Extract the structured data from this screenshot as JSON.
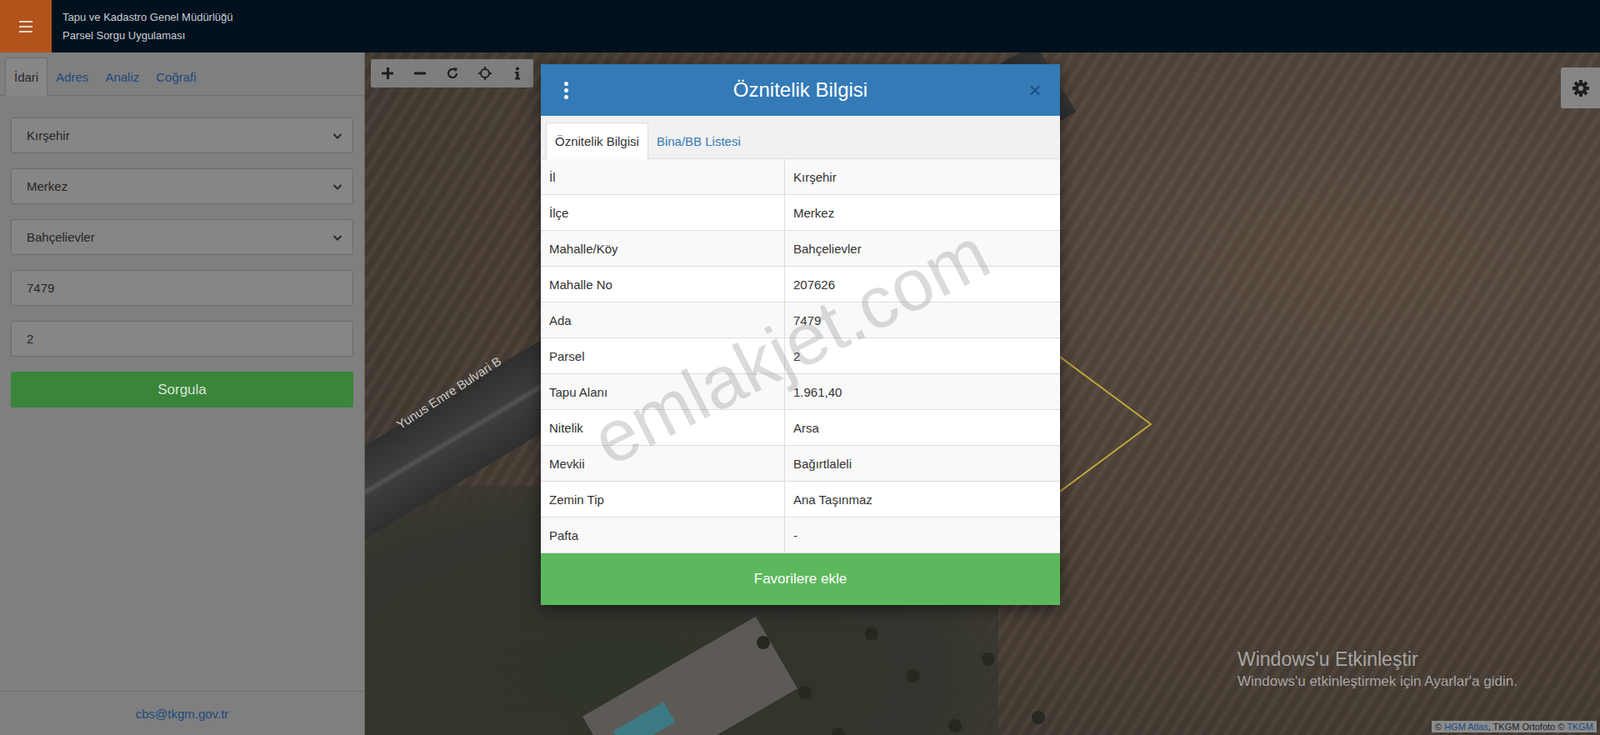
{
  "header": {
    "title_line1": "Tapu ve Kadastro Genel Müdürlüğü",
    "title_line2": "Parsel Sorgu Uygulaması"
  },
  "sidebar": {
    "tabs": [
      {
        "label": "İdari",
        "selected": true
      },
      {
        "label": "Adres",
        "selected": false
      },
      {
        "label": "Analiz",
        "selected": false
      },
      {
        "label": "Coğrafi",
        "selected": false
      }
    ],
    "fields": [
      {
        "kind": "select",
        "value": "Kırşehir"
      },
      {
        "kind": "select",
        "value": "Merkez"
      },
      {
        "kind": "select",
        "value": "Bahçelievler"
      },
      {
        "kind": "input",
        "value": "7479"
      },
      {
        "kind": "input",
        "value": "2"
      }
    ],
    "button": "Sorgula",
    "footer": "cbs@tkgm.gov.tr"
  },
  "map": {
    "road_label": "Yunus Emre Bulvari B",
    "attribution": [
      {
        "text": "© ",
        "link": false
      },
      {
        "text": "HGM Atlas",
        "link": true
      },
      {
        "text": ", TKGM Ortofoto © ",
        "link": false
      },
      {
        "text": "TKGM",
        "link": true
      }
    ]
  },
  "modal": {
    "title": "Öznitelik Bilgisi",
    "close": "×",
    "tabs": [
      {
        "label": "Öznitelik Bilgisi",
        "selected": true
      },
      {
        "label": "Bina/BB Listesi",
        "selected": false
      }
    ],
    "rows": [
      {
        "label": "İl",
        "value": "Kırşehir"
      },
      {
        "label": "İlçe",
        "value": "Merkez"
      },
      {
        "label": "Mahalle/Köy",
        "value": "Bahçelievler"
      },
      {
        "label": "Mahalle No",
        "value": "207626"
      },
      {
        "label": "Ada",
        "value": "7479"
      },
      {
        "label": "Parsel",
        "value": "2"
      },
      {
        "label": "Tapu Alanı",
        "value": "1.961,40"
      },
      {
        "label": "Nitelik",
        "value": "Arsa"
      },
      {
        "label": "Mevkii",
        "value": "Bağırtlaleli"
      },
      {
        "label": "Zemin Tip",
        "value": "Ana Taşınmaz"
      },
      {
        "label": "Pafta",
        "value": "-"
      }
    ],
    "button": "Favorilere ekle"
  },
  "watermark": "emlakjet.com",
  "activation": {
    "title": "Windows'u Etkinleştir",
    "subtitle": "Windows'u etkinleştirmek için Ayarlar'a gidin."
  }
}
